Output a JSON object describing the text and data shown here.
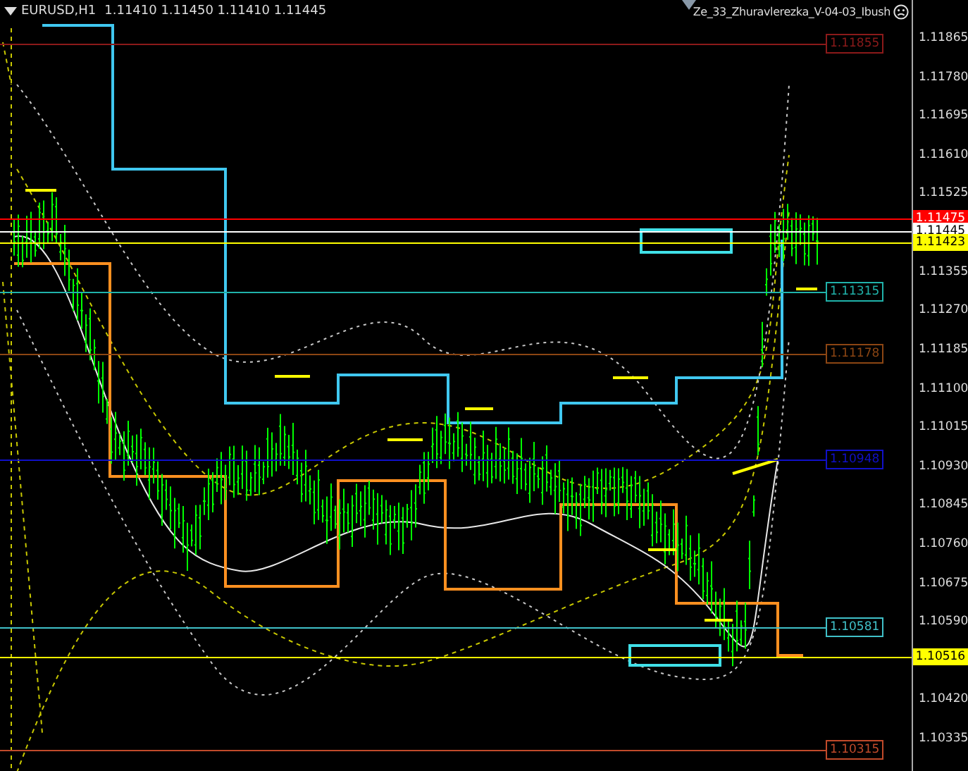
{
  "header": {
    "symbol": "EURUSD,H1",
    "ohlc": "1.11410 1.11450 1.11410 1.11445"
  },
  "expert": {
    "name": "Ze_33_Zhuravlerezka_V-04-03_Ibush"
  },
  "price_axis": {
    "ticks": [
      "1.11865",
      "1.11780",
      "1.11695",
      "1.11610",
      "1.11525",
      "1.11355",
      "1.11270",
      "1.11185",
      "1.11100",
      "1.11015",
      "1.10930",
      "1.10845",
      "1.10760",
      "1.10675",
      "1.10590",
      "1.10420",
      "1.10335"
    ]
  },
  "levels": [
    {
      "price": "1.11855",
      "kind": "boxed",
      "color": "#8b1a1a"
    },
    {
      "price": "1.11475",
      "kind": "axis",
      "color": "#ff0000"
    },
    {
      "price": "1.11445",
      "kind": "axis",
      "color": "#ffffff"
    },
    {
      "price": "1.11423",
      "kind": "axis",
      "color": "#ffff00"
    },
    {
      "price": "1.11315",
      "kind": "boxed",
      "color": "#20b2aa"
    },
    {
      "price": "1.11178",
      "kind": "boxed",
      "color": "#8b4513"
    },
    {
      "price": "1.10948",
      "kind": "boxed",
      "color": "#1010c8"
    },
    {
      "price": "1.10581",
      "kind": "boxed",
      "color": "#40c0c8"
    },
    {
      "price": "1.10516",
      "kind": "axis",
      "color": "#ffff00"
    },
    {
      "price": "1.10315",
      "kind": "boxed",
      "color": "#c04a2a"
    }
  ]
}
